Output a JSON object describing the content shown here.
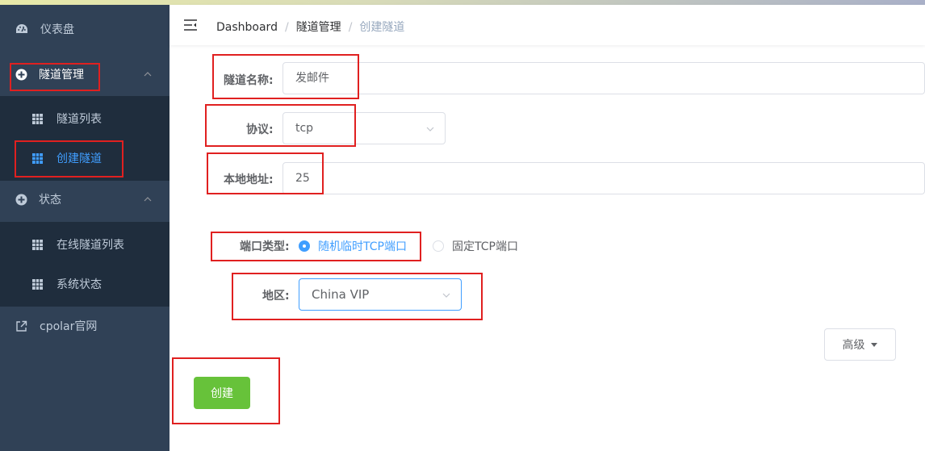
{
  "sidebar": {
    "items": [
      {
        "label": "仪表盘",
        "icon": "dashboard-icon"
      },
      {
        "label": "隧道管理",
        "icon": "circle-plus-icon",
        "expanded": true
      },
      {
        "label": "隧道列表",
        "icon": "grid-icon"
      },
      {
        "label": "创建隧道",
        "icon": "grid-icon",
        "active": true
      },
      {
        "label": "状态",
        "icon": "circle-plus-icon",
        "expanded": true
      },
      {
        "label": "在线隧道列表",
        "icon": "grid-icon"
      },
      {
        "label": "系统状态",
        "icon": "grid-icon"
      },
      {
        "label": "cpolar官网",
        "icon": "external-link-icon"
      }
    ]
  },
  "header": {
    "breadcrumb": [
      "Dashboard",
      "隧道管理",
      "创建隧道"
    ],
    "separator": "/"
  },
  "form": {
    "tunnel_name_label": "隧道名称:",
    "tunnel_name_value": "发邮件",
    "protocol_label": "协议:",
    "protocol_value": "tcp",
    "local_address_label": "本地地址:",
    "local_address_value": "25",
    "port_type_label": "端口类型:",
    "port_type_options": [
      "随机临时TCP端口",
      "固定TCP端口"
    ],
    "port_type_selected": "随机临时TCP端口",
    "region_label": "地区:",
    "region_value": "China VIP",
    "advanced_button": "高级",
    "create_button": "创建"
  },
  "colors": {
    "sidebar_bg": "#304156",
    "submenu_bg": "#1f2d3d",
    "accent": "#409eff",
    "success": "#67c23a",
    "highlight_box": "#e02020"
  }
}
